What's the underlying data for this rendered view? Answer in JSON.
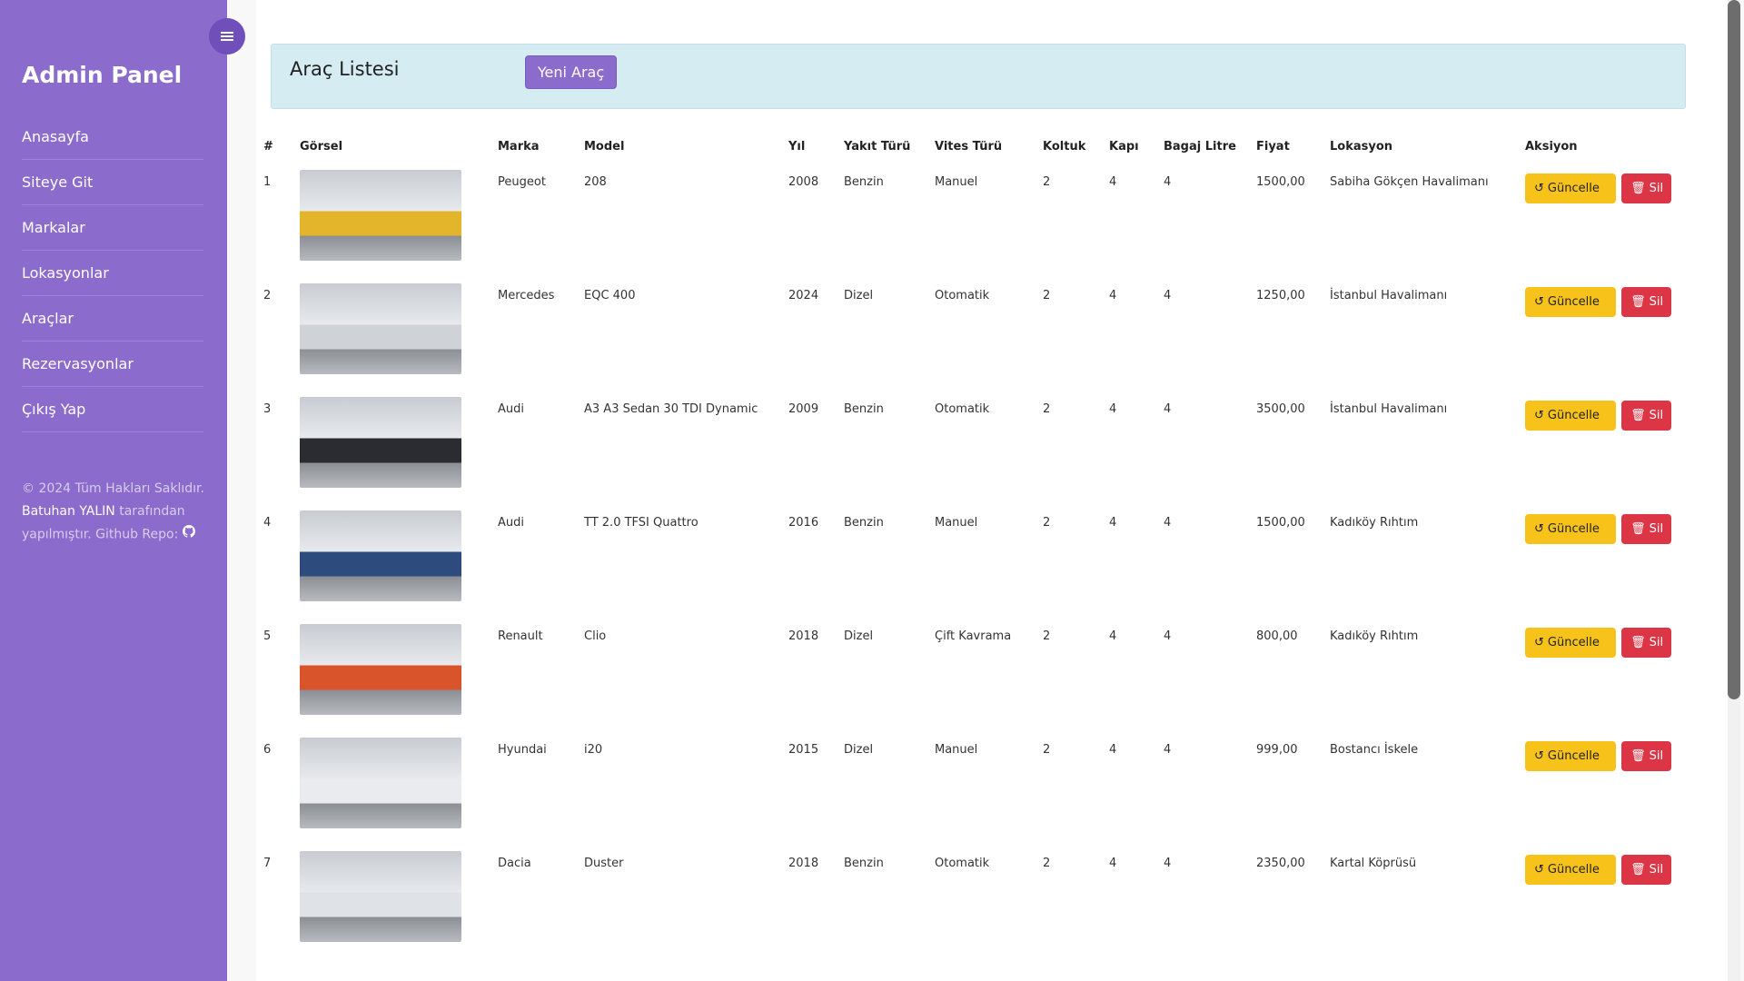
{
  "sidebar": {
    "brand": "Admin Panel",
    "items": [
      {
        "label": "Anasayfa"
      },
      {
        "label": "Siteye Git"
      },
      {
        "label": "Markalar"
      },
      {
        "label": "Lokasyonlar"
      },
      {
        "label": "Araçlar"
      },
      {
        "label": "Rezervasyonlar"
      },
      {
        "label": "Çıkış Yap"
      }
    ],
    "footer": {
      "line1": "© 2024 Tüm Hakları Saklıdır.",
      "author": "Batuhan YALIN",
      "line2": "tarafından yapılmıştır. Github Repo:"
    }
  },
  "header": {
    "title": "Araç Listesi",
    "new_button": "Yeni Araç"
  },
  "table": {
    "columns": [
      "#",
      "Görsel",
      "Marka",
      "Model",
      "Yıl",
      "Yakıt Türü",
      "Vites Türü",
      "Koltuk",
      "Kapı",
      "Bagaj Litre",
      "Fiyat",
      "Lokasyon",
      "Aksiyon"
    ],
    "update_label": "Güncelle",
    "delete_label": "Sil",
    "rows": [
      {
        "no": "1",
        "marka": "Peugeot",
        "model": "208",
        "yil": "2008",
        "yakit": "Benzin",
        "vites": "Manuel",
        "koltuk": "2",
        "kapi": "4",
        "bagaj": "4",
        "fiyat": "1500,00",
        "lokasyon": "Sabiha Gökçen Havalimanı",
        "img_color": "#e3b52a"
      },
      {
        "no": "2",
        "marka": "Mercedes",
        "model": "EQC 400",
        "yil": "2024",
        "yakit": "Dizel",
        "vites": "Otomatik",
        "koltuk": "2",
        "kapi": "4",
        "bagaj": "4",
        "fiyat": "1250,00",
        "lokasyon": "İstanbul Havalimanı",
        "img_color": "#cfd3d8"
      },
      {
        "no": "3",
        "marka": "Audi",
        "model": "A3 A3 Sedan 30 TDI Dynamic",
        "yil": "2009",
        "yakit": "Benzin",
        "vites": "Otomatik",
        "koltuk": "2",
        "kapi": "4",
        "bagaj": "4",
        "fiyat": "3500,00",
        "lokasyon": "İstanbul Havalimanı",
        "img_color": "#2a2c31"
      },
      {
        "no": "4",
        "marka": "Audi",
        "model": "TT 2.0 TFSI Quattro",
        "yil": "2016",
        "yakit": "Benzin",
        "vites": "Manuel",
        "koltuk": "2",
        "kapi": "4",
        "bagaj": "4",
        "fiyat": "1500,00",
        "lokasyon": "Kadıköy Rıhtım",
        "img_color": "#2d4b7c"
      },
      {
        "no": "5",
        "marka": "Renault",
        "model": "Clio",
        "yil": "2018",
        "yakit": "Dizel",
        "vites": "Çift Kavrama",
        "koltuk": "2",
        "kapi": "4",
        "bagaj": "4",
        "fiyat": "800,00",
        "lokasyon": "Kadıköy Rıhtım",
        "img_color": "#d9532b"
      },
      {
        "no": "6",
        "marka": "Hyundai",
        "model": "i20",
        "yil": "2015",
        "yakit": "Dizel",
        "vites": "Manuel",
        "koltuk": "2",
        "kapi": "4",
        "bagaj": "4",
        "fiyat": "999,00",
        "lokasyon": "Bostancı İskele",
        "img_color": "#e9ebee"
      },
      {
        "no": "7",
        "marka": "Dacia",
        "model": "Duster",
        "yil": "2018",
        "yakit": "Benzin",
        "vites": "Otomatik",
        "koltuk": "2",
        "kapi": "4",
        "bagaj": "4",
        "fiyat": "2350,00",
        "lokasyon": "Kartal Köprüsü",
        "img_color": "#dfe2e6"
      }
    ]
  }
}
